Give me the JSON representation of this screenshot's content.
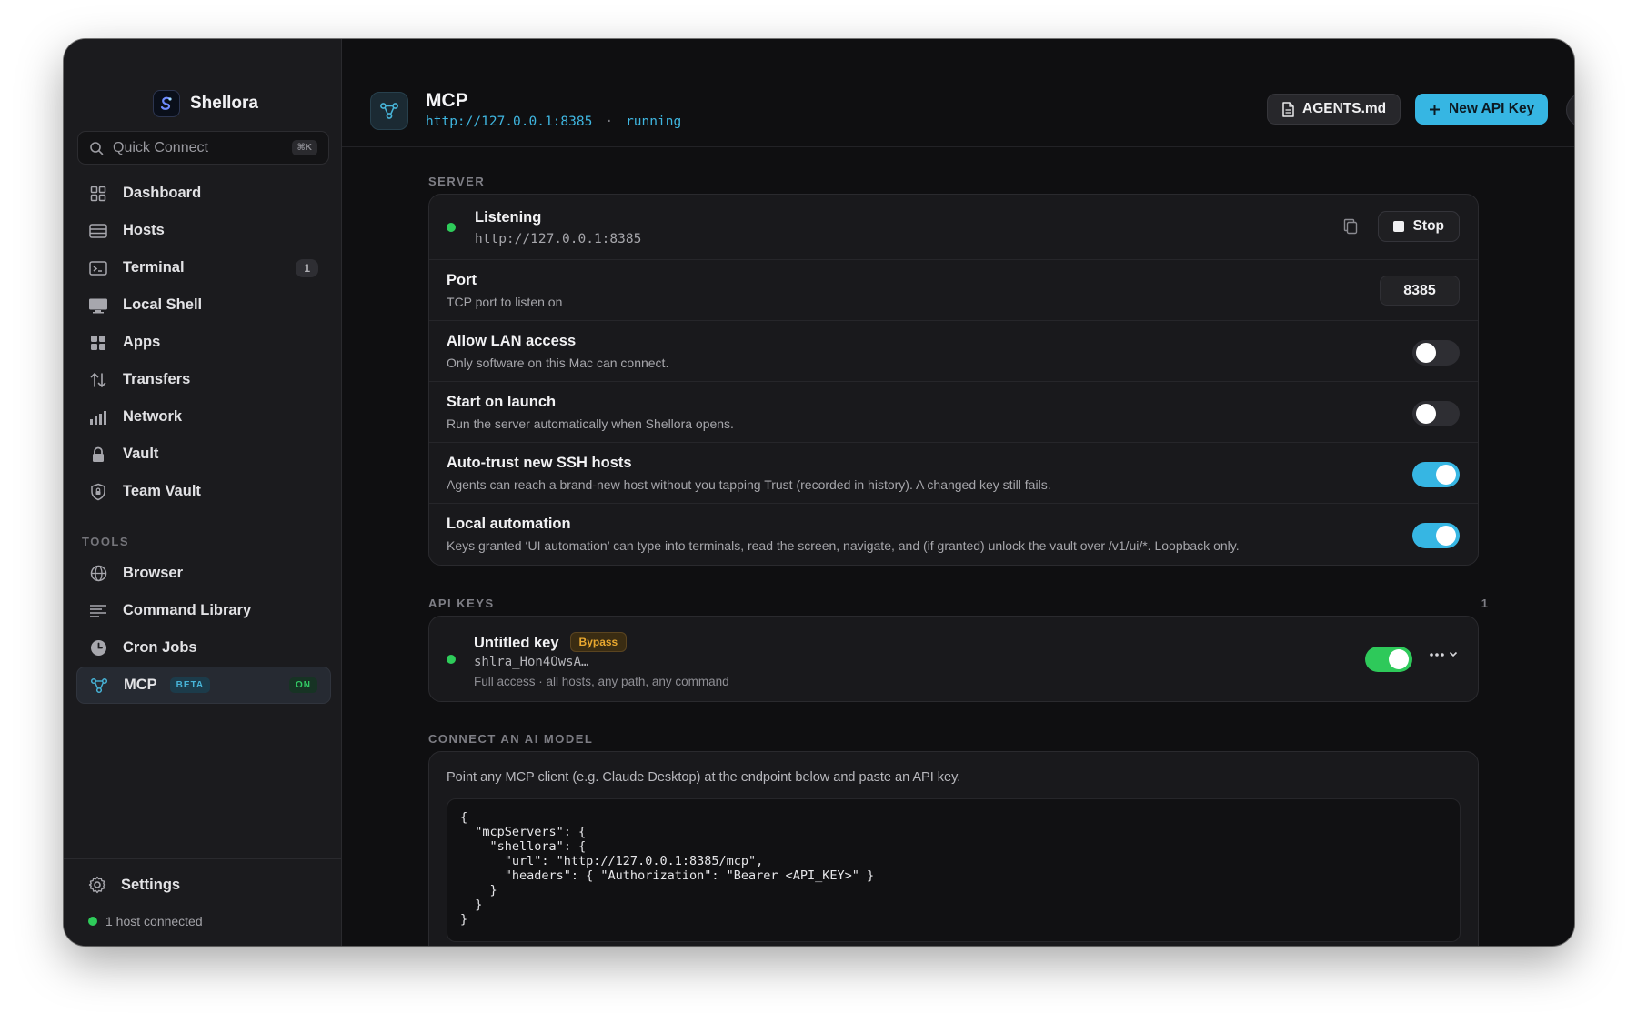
{
  "app": {
    "name": "Shellora"
  },
  "sidebar": {
    "quick_connect": {
      "label": "Quick Connect",
      "shortcut": "⌘K"
    },
    "items": [
      {
        "label": "Dashboard",
        "icon": "dashboard-icon"
      },
      {
        "label": "Hosts",
        "icon": "hosts-icon"
      },
      {
        "label": "Terminal",
        "icon": "terminal-icon",
        "count": "1"
      },
      {
        "label": "Local Shell",
        "icon": "monitor-icon"
      },
      {
        "label": "Apps",
        "icon": "apps-grid-icon"
      },
      {
        "label": "Transfers",
        "icon": "transfers-icon"
      },
      {
        "label": "Network",
        "icon": "network-bars-icon"
      },
      {
        "label": "Vault",
        "icon": "lock-icon"
      },
      {
        "label": "Team Vault",
        "icon": "shield-icon"
      }
    ],
    "tools_heading": "TOOLS",
    "tools": [
      {
        "label": "Browser",
        "icon": "globe-icon"
      },
      {
        "label": "Command Library",
        "icon": "list-icon"
      },
      {
        "label": "Cron Jobs",
        "icon": "clock-icon"
      },
      {
        "label": "MCP",
        "icon": "mcp-icon",
        "badge": "BETA",
        "status": "ON",
        "active": true
      }
    ],
    "settings_label": "Settings",
    "host_status": "1 host connected"
  },
  "header": {
    "title": "MCP",
    "endpoint": "http://127.0.0.1:8385",
    "separator": "·",
    "status": "running",
    "agents_button": "AGENTS.md",
    "new_key_button": "New API Key",
    "help_label": "?"
  },
  "server": {
    "heading": "SERVER",
    "listening": {
      "title": "Listening",
      "url": "http://127.0.0.1:8385",
      "stop_label": "Stop"
    },
    "port": {
      "title": "Port",
      "desc": "TCP port to listen on",
      "value": "8385"
    },
    "lan": {
      "title": "Allow LAN access",
      "desc": "Only software on this Mac can connect.",
      "enabled": false
    },
    "launch": {
      "title": "Start on launch",
      "desc": "Run the server automatically when Shellora opens.",
      "enabled": false
    },
    "autotrust": {
      "title": "Auto-trust new SSH hosts",
      "desc": "Agents can reach a brand-new host without you tapping Trust (recorded in history). A changed key still fails.",
      "enabled": true
    },
    "automation": {
      "title": "Local automation",
      "desc": "Keys granted ‘UI automation’ can type into terminals, read the screen, navigate, and (if granted) unlock the vault over /v1/ui/*. Loopback only.",
      "enabled": true
    }
  },
  "api_keys": {
    "heading": "API KEYS",
    "count": "1",
    "keys": [
      {
        "name": "Untitled key",
        "badge": "Bypass",
        "token": "shlra_Hon4OwsA…",
        "scope": "Full access · all hosts, any path, any command",
        "enabled": true
      }
    ]
  },
  "connect": {
    "heading": "CONNECT AN AI MODEL",
    "desc": "Point any MCP client (e.g. Claude Desktop) at the endpoint below and paste an API key.",
    "code": "{\n  \"mcpServers\": {\n    \"shellora\": {\n      \"url\": \"http://127.0.0.1:8385/mcp\",\n      \"headers\": { \"Authorization\": \"Bearer <API_KEY>\" }\n    }\n  }\n}"
  },
  "colors": {
    "accent": "#36b6e3",
    "success": "#2ec95a",
    "warning": "#e9a82f",
    "background": "#0f0f11",
    "sidebar": "#1b1b1e"
  }
}
